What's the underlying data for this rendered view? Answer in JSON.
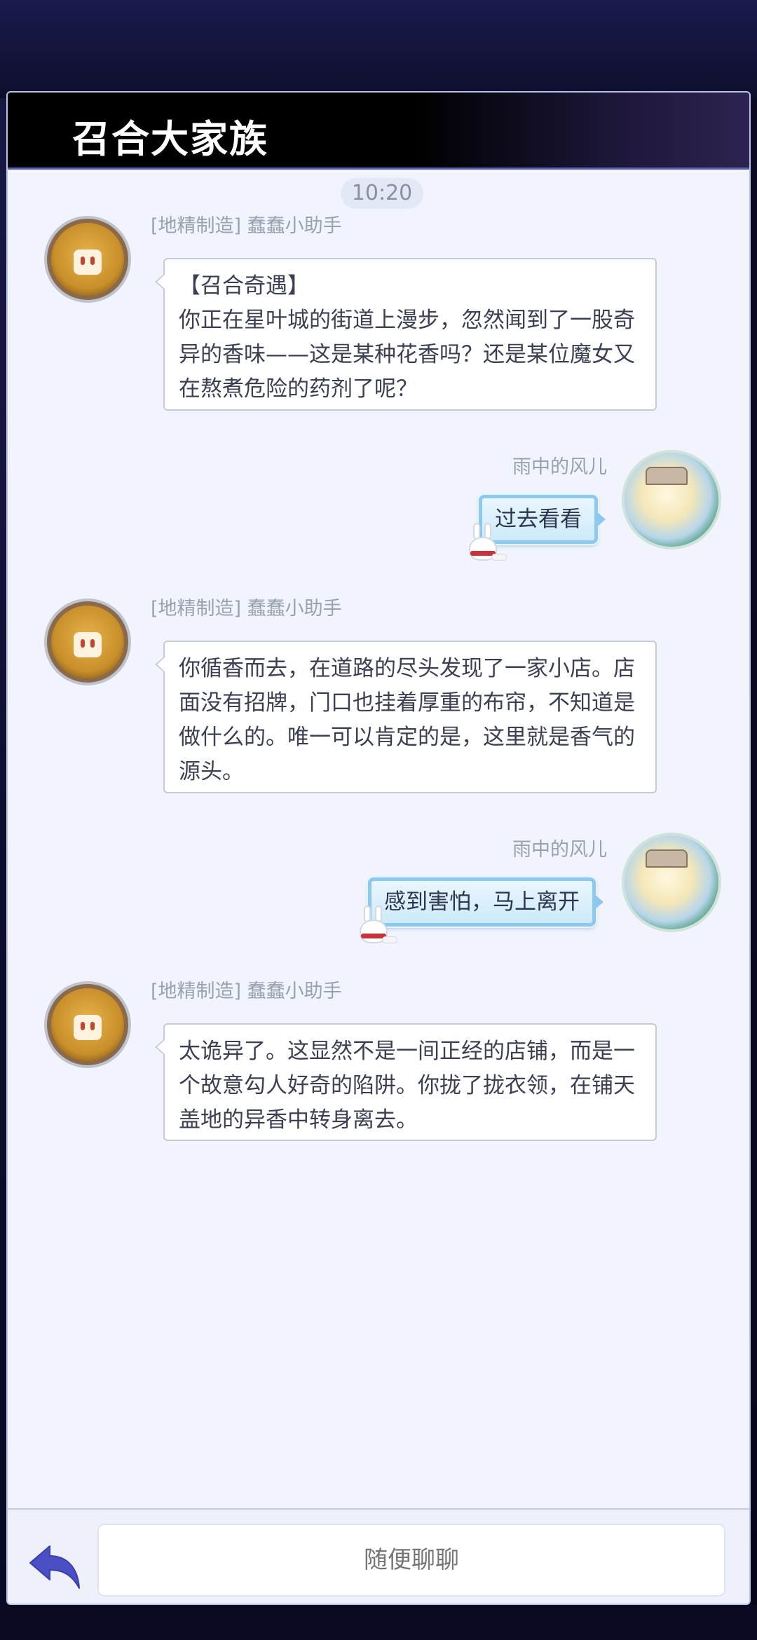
{
  "header": {
    "title": "召合大家族"
  },
  "timestamp": "10:20",
  "messages": [
    {
      "sender": "[地精制造] 蠢蠢小助手",
      "side": "left",
      "lines": [
        "【召合奇遇】",
        "你正在星叶城的街道上漫步，忽然闻到了一股奇",
        "异的香味——这是某种花香吗？还是某位魔女又",
        "在熬煮危险的药剂了呢？"
      ]
    },
    {
      "sender": "雨中的风儿",
      "side": "right",
      "text": "过去看看"
    },
    {
      "sender": "[地精制造] 蠢蠢小助手",
      "side": "left",
      "lines": [
        "你循香而去，在道路的尽头发现了一家小店。店",
        "面没有招牌，门口也挂着厚重的布帘，不知道是",
        "做什么的。唯一可以肯定的是，这里就是香气的",
        "源头。"
      ]
    },
    {
      "sender": "雨中的风儿",
      "side": "right",
      "text": "感到害怕，马上离开"
    },
    {
      "sender": "[地精制造] 蠢蠢小助手",
      "side": "left",
      "lines": [
        "太诡异了。这显然不是一间正经的店铺，而是一",
        "个故意勾人好奇的陷阱。你拢了拢衣领，在铺天",
        "盖地的异香中转身离去。"
      ]
    }
  ],
  "footer": {
    "input_placeholder": "随便聊聊",
    "back_icon": "back-arrow-icon"
  },
  "colors": {
    "accent": "#4b4fc4",
    "bubble_user_border": "#8ec8ee"
  }
}
